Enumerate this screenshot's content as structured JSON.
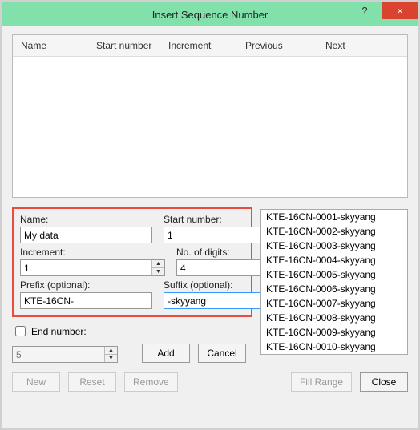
{
  "title": "Insert Sequence Number",
  "columns": {
    "name": "Name",
    "start": "Start number",
    "increment": "Increment",
    "previous": "Previous",
    "next": "Next"
  },
  "labels": {
    "name": "Name:",
    "start": "Start number:",
    "increment": "Increment:",
    "digits": "No. of digits:",
    "prefix": "Prefix (optional):",
    "suffix": "Suffix (optional):",
    "end": "End number:"
  },
  "values": {
    "name": "My data",
    "start": "1",
    "increment": "1",
    "digits": "4",
    "prefix": "KTE-16CN-",
    "suffix": "-skyyang",
    "end": "5"
  },
  "buttons": {
    "add": "Add",
    "cancel": "Cancel",
    "new": "New",
    "reset": "Reset",
    "remove": "Remove",
    "fill": "Fill Range",
    "close": "Close"
  },
  "preview": [
    "KTE-16CN-0001-skyyang",
    "KTE-16CN-0002-skyyang",
    "KTE-16CN-0003-skyyang",
    "KTE-16CN-0004-skyyang",
    "KTE-16CN-0005-skyyang",
    "KTE-16CN-0006-skyyang",
    "KTE-16CN-0007-skyyang",
    "KTE-16CN-0008-skyyang",
    "KTE-16CN-0009-skyyang",
    "KTE-16CN-0010-skyyang"
  ]
}
